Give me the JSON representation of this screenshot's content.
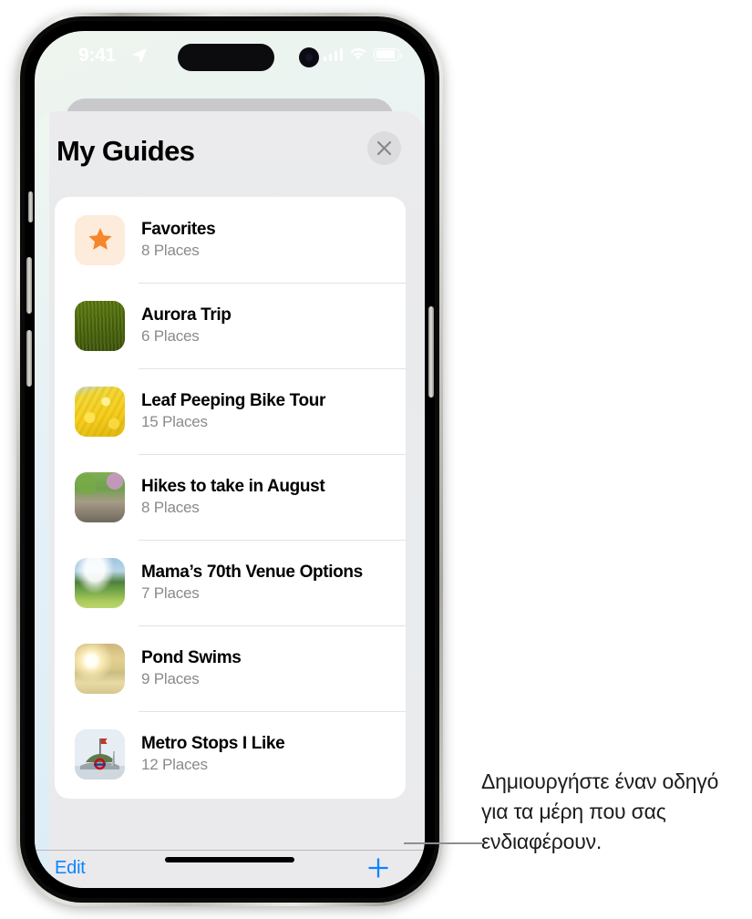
{
  "status_bar": {
    "time": "9:41",
    "location_icon": "location-arrow-icon",
    "cellular_icon": "cellular-bars-icon",
    "wifi_icon": "wifi-icon",
    "battery_icon": "battery-icon"
  },
  "sheet": {
    "title": "My Guides",
    "close_icon": "close-x-icon"
  },
  "guides": [
    {
      "title": "Favorites",
      "places": "8 Places",
      "thumb": "star-icon"
    },
    {
      "title": "Aurora Trip",
      "places": "6 Places",
      "thumb": "green-field-photo"
    },
    {
      "title": "Leaf Peeping Bike Tour",
      "places": "15 Places",
      "thumb": "yellow-foliage-photo"
    },
    {
      "title": "Hikes to take in August",
      "places": "8 Places",
      "thumb": "forest-trail-photo"
    },
    {
      "title": "Mama’s 70th Venue Options",
      "places": "7 Places",
      "thumb": "meadow-clouds-photo"
    },
    {
      "title": "Pond Swims",
      "places": "9 Places",
      "thumb": "sunset-pond-photo"
    },
    {
      "title": "Metro Stops I Like",
      "places": "12 Places",
      "thumb": "metro-monument-photo"
    }
  ],
  "toolbar": {
    "edit_label": "Edit",
    "add_icon": "plus-icon"
  },
  "callout": {
    "text": "Δημιουργήστε έναν οδηγό για τα μέρη που σας ενδιαφέρουν."
  },
  "colors": {
    "accent_blue": "#0a84ff",
    "star_orange": "#f5862a",
    "subtitle_gray": "#8a8a8e",
    "callout_gray": "#8e8e90"
  }
}
